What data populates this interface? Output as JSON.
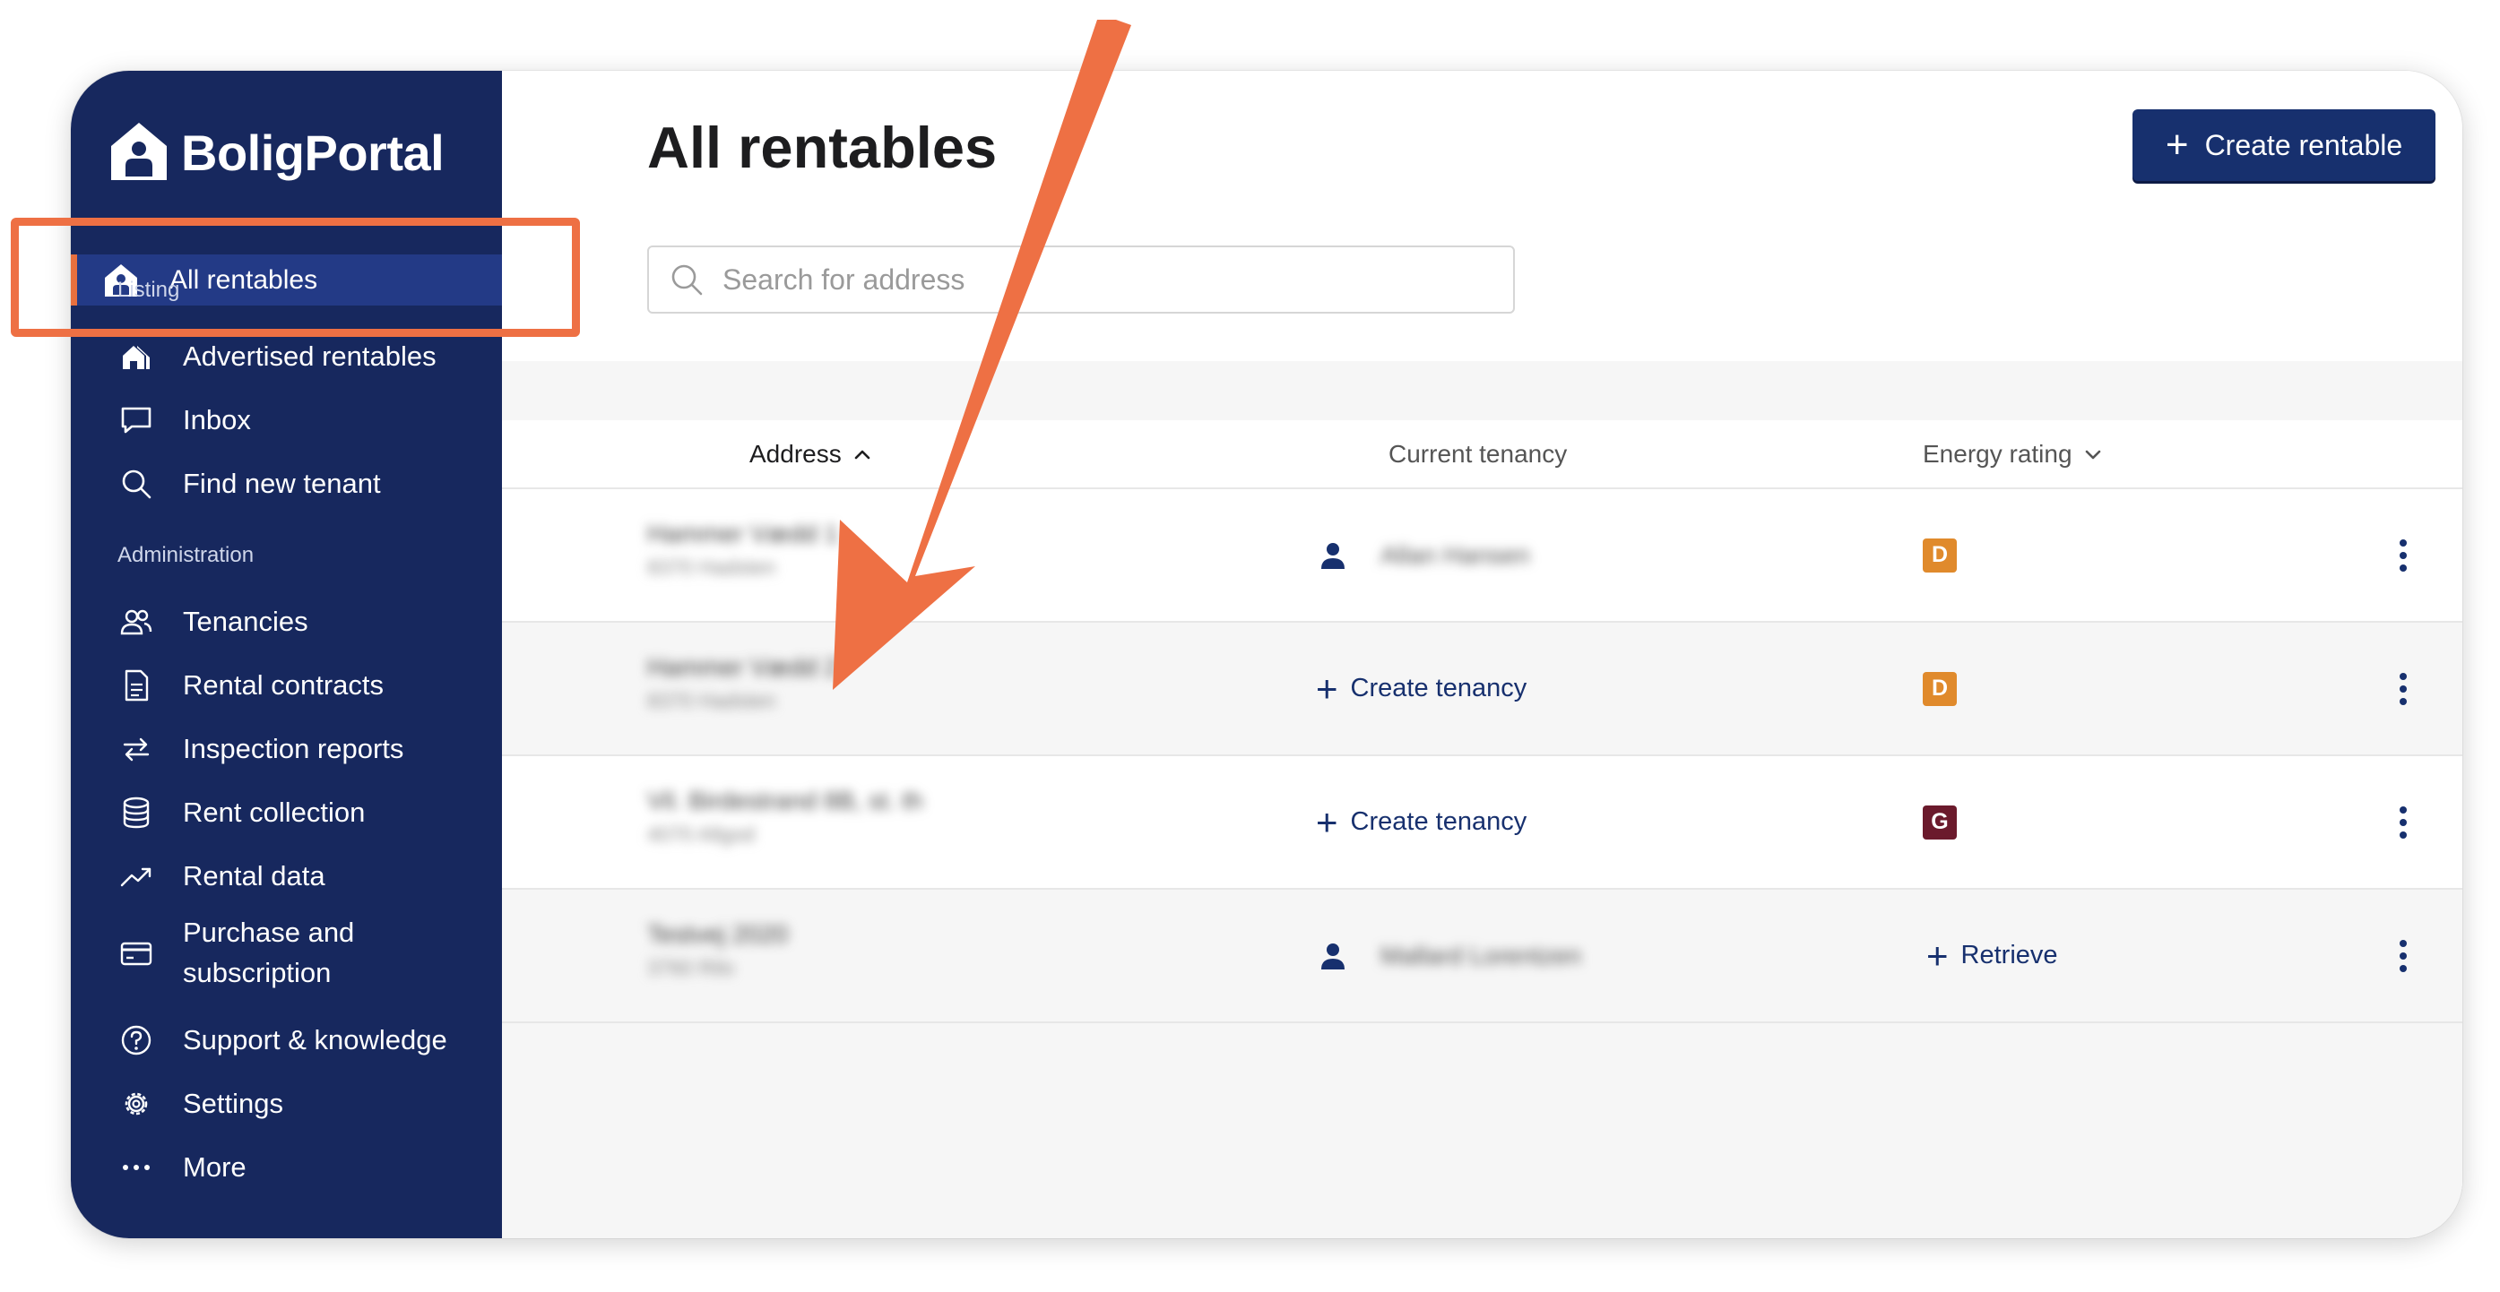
{
  "app": {
    "brand": "BoligPortal"
  },
  "sidebar": {
    "active_item": "All rentables",
    "section_listing": "Listing",
    "section_administration": "Administration",
    "listing_items": [
      {
        "label": "Advertised rentables",
        "icon": "houses-icon"
      },
      {
        "label": "Inbox",
        "icon": "chat-bubble-icon"
      },
      {
        "label": "Find new tenant",
        "icon": "search-icon"
      }
    ],
    "admin_items": [
      {
        "label": "Tenancies",
        "icon": "people-icon"
      },
      {
        "label": "Rental contracts",
        "icon": "document-icon"
      },
      {
        "label": "Inspection reports",
        "icon": "swap-arrows-icon"
      },
      {
        "label": "Rent collection",
        "icon": "database-icon"
      },
      {
        "label": "Rental data",
        "icon": "trend-up-icon"
      },
      {
        "label": "Purchase and subscription",
        "icon": "credit-card-icon"
      },
      {
        "label": "Support & knowledge",
        "icon": "help-circle-icon"
      },
      {
        "label": "Settings",
        "icon": "gear-icon"
      },
      {
        "label": "More",
        "icon": "more-dots-icon"
      }
    ]
  },
  "main": {
    "title": "All rentables",
    "create_button": "Create rentable",
    "search_placeholder": "Search for address"
  },
  "table": {
    "columns": {
      "address": "Address",
      "tenancy": "Current tenancy",
      "energy": "Energy rating"
    },
    "create_tenancy_label": "Create tenancy",
    "retrieve_label": "Retrieve",
    "rows": [
      {
        "address": "Hammer Vædd 1",
        "city": "8370 Hadsten",
        "tenant": "Allan Hansen",
        "energy": "D"
      },
      {
        "address": "Hammer Vædd 2",
        "city": "8370 Hadsten",
        "tenant": "",
        "energy": "D"
      },
      {
        "address": "Vil. Birdestrand 8B, st. th",
        "city": "4070 Allgod",
        "tenant": "",
        "energy": "G"
      },
      {
        "address": "Testvej 2020",
        "city": "3760 Rilo",
        "tenant": "Mallard Lorentzen",
        "energy": ""
      }
    ]
  },
  "colors": {
    "sidebar_bg": "#17285e",
    "accent": "#17306e",
    "annotation": "#ee7044",
    "energy_D": "#e08a2c",
    "energy_G": "#6b1a2c"
  }
}
